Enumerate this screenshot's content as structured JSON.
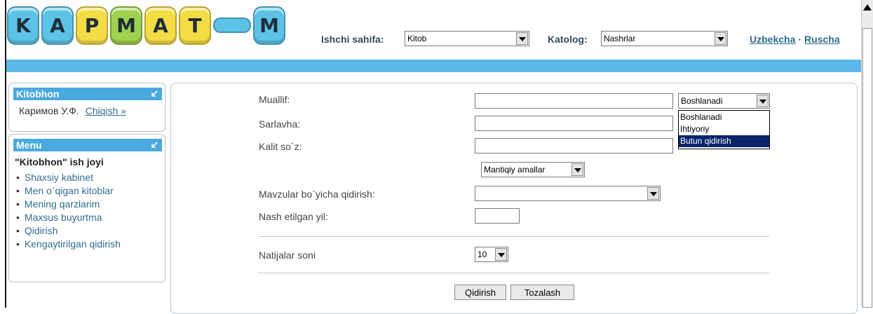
{
  "logo": {
    "letters": [
      "K",
      "A",
      "P",
      "M",
      "A",
      "T",
      "M"
    ]
  },
  "header": {
    "workpage_label": "Ishchi sahifa:",
    "workpage_value": "Kitob",
    "catalog_label": "Katolog:",
    "catalog_value": "Nashrlar",
    "lang_uz": "Uzbekcha",
    "lang_sep": "·",
    "lang_ru": "Ruscha"
  },
  "reader_panel": {
    "title": "Kitobhon",
    "user_name": "Каримов У.Ф.",
    "logout": "Chiqish »"
  },
  "menu_panel": {
    "title": "Menu",
    "section_title": "\"Kitobhon\" ish joyi",
    "items": [
      "Shaxsiy kabinet",
      "Men o`qigan kitoblar",
      "Mening qarzlarim",
      "Maxsus buyurtma",
      "Qidirish",
      "Kengaytirilgan qidirish"
    ]
  },
  "search_form": {
    "author_label": "Muallif:",
    "title_label": "Sarlavha:",
    "keyword_label": "Kalit so`z:",
    "match_mode_value": "Boshlanadi",
    "match_mode_options": [
      "Boshlanadi",
      "Ihtiyoriy",
      "Butun qidirish"
    ],
    "match_mode_highlighted": "Butun qidirish",
    "logic_ops_value": "Mantiqiy amallar",
    "subject_label": "Mavzular bo`yicha qidirish:",
    "subject_value": "",
    "year_label": "Nash etilgan yil:",
    "year_value": "",
    "results_label": "Natijalar soni",
    "results_value": "10",
    "search_button": "Qidirish",
    "clear_button": "Tozalash"
  },
  "colors": {
    "accent_blue": "#5bb7e7",
    "panel_head": "#4aa9df",
    "link": "#2f6d8f",
    "dropdown_highlight": "#0a246a"
  }
}
